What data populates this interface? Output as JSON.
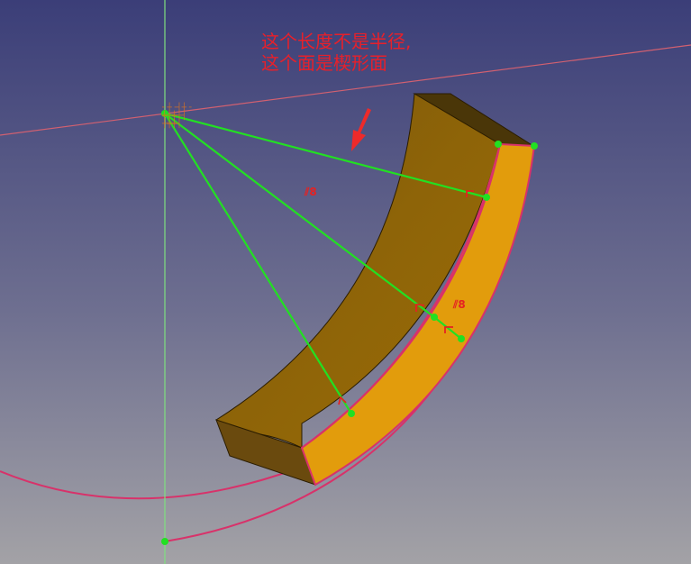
{
  "annotation": {
    "line1": "这个长度不是半径,",
    "line2": "这个面是楔形面"
  },
  "constraints": {
    "label_upper": "8",
    "label_right": "8",
    "symbol": "⫽"
  },
  "colors": {
    "background_top": "#3b3e78",
    "background_bottom": "#a3a2a6",
    "solid_top_face": "#8a6208",
    "solid_end_face": "#6a4a0e",
    "wedge_face": "#e29c0c",
    "sketch_line": "#22e022",
    "construction_line": "#d8326a",
    "axis_line": "#7fe07f",
    "annotation": "#e8202a",
    "arrow": "#ee2a2a"
  }
}
